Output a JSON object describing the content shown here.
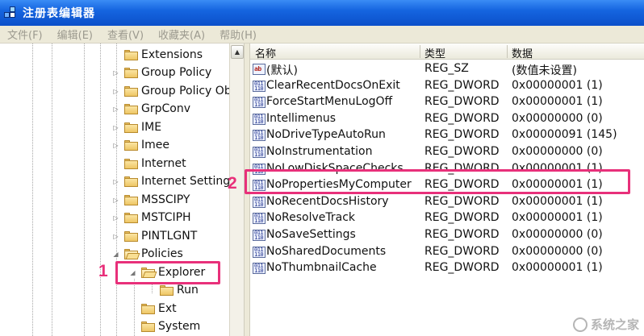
{
  "window": {
    "title": "注册表编辑器",
    "icon": "registry-editor-icon"
  },
  "menu": [
    "文件(F)",
    "编辑(E)",
    "查看(V)",
    "收藏夹(A)",
    "帮助(H)"
  ],
  "tree": {
    "items": [
      {
        "label": "Extensions",
        "expander": "",
        "level": 0
      },
      {
        "label": "Group Policy",
        "expander": "▷",
        "level": 0
      },
      {
        "label": "Group Policy Ob",
        "expander": "▷",
        "level": 0
      },
      {
        "label": "GrpConv",
        "expander": "▷",
        "level": 0
      },
      {
        "label": "IME",
        "expander": "▷",
        "level": 0
      },
      {
        "label": "Imee",
        "expander": "▷",
        "level": 0
      },
      {
        "label": "Internet",
        "expander": "",
        "level": 0
      },
      {
        "label": "Internet Setting",
        "expander": "▷",
        "level": 0
      },
      {
        "label": "MSSCIPY",
        "expander": "▷",
        "level": 0
      },
      {
        "label": "MSTCIPH",
        "expander": "▷",
        "level": 0
      },
      {
        "label": "PINTLGNT",
        "expander": "▷",
        "level": 0
      },
      {
        "label": "Policies",
        "expander": "◢",
        "level": 0
      },
      {
        "label": "Explorer",
        "expander": "◢",
        "level": 1,
        "selected": true
      },
      {
        "label": "Run",
        "expander": "",
        "level": 2
      },
      {
        "label": "Ext",
        "expander": "",
        "level": 1
      },
      {
        "label": "System",
        "expander": "",
        "level": 1
      }
    ]
  },
  "list": {
    "columns": {
      "name": "名称",
      "type": "类型",
      "data": "数据"
    },
    "rows": [
      {
        "name": "(默认)",
        "type": "REG_SZ",
        "data": "(数值未设置)",
        "icon": "string-value-icon",
        "glyph": "ab"
      },
      {
        "name": "ClearRecentDocsOnExit",
        "type": "REG_DWORD",
        "data": "0x00000001 (1)",
        "icon": "binary-value-icon",
        "glyph": "011 110"
      },
      {
        "name": "ForceStartMenuLogOff",
        "type": "REG_DWORD",
        "data": "0x00000001 (1)",
        "icon": "binary-value-icon",
        "glyph": "011 110"
      },
      {
        "name": "Intellimenus",
        "type": "REG_DWORD",
        "data": "0x00000000 (0)",
        "icon": "binary-value-icon",
        "glyph": "011 110"
      },
      {
        "name": "NoDriveTypeAutoRun",
        "type": "REG_DWORD",
        "data": "0x00000091 (145)",
        "icon": "binary-value-icon",
        "glyph": "011 110"
      },
      {
        "name": "NoInstrumentation",
        "type": "REG_DWORD",
        "data": "0x00000000 (0)",
        "icon": "binary-value-icon",
        "glyph": "011 110"
      },
      {
        "name": "NoLowDiskSpaceChecks",
        "type": "REG_DWORD",
        "data": "0x00000001 (1)",
        "icon": "binary-value-icon",
        "glyph": "011 110"
      },
      {
        "name": "NoPropertiesMyComputer",
        "type": "REG_DWORD",
        "data": "0x00000001 (1)",
        "icon": "binary-value-icon",
        "glyph": "011 110"
      },
      {
        "name": "NoRecentDocsHistory",
        "type": "REG_DWORD",
        "data": "0x00000001 (1)",
        "icon": "binary-value-icon",
        "glyph": "011 110"
      },
      {
        "name": "NoResolveTrack",
        "type": "REG_DWORD",
        "data": "0x00000001 (1)",
        "icon": "binary-value-icon",
        "glyph": "011 110"
      },
      {
        "name": "NoSaveSettings",
        "type": "REG_DWORD",
        "data": "0x00000000 (0)",
        "icon": "binary-value-icon",
        "glyph": "011 110"
      },
      {
        "name": "NoSharedDocuments",
        "type": "REG_DWORD",
        "data": "0x00000000 (0)",
        "icon": "binary-value-icon",
        "glyph": "011 110"
      },
      {
        "name": "NoThumbnailCache",
        "type": "REG_DWORD",
        "data": "0x00000001 (1)",
        "icon": "binary-value-icon",
        "glyph": "011 110"
      }
    ]
  },
  "annotations": {
    "step1": "1",
    "step2": "2",
    "color": "#e8307a"
  },
  "watermark": {
    "text": "系统之家",
    "icon": "watermark-logo-icon"
  },
  "colors": {
    "titlebar": "#1565e0",
    "menubar_bg": "#ece9d8",
    "menubar_text": "#9c9a8f"
  }
}
